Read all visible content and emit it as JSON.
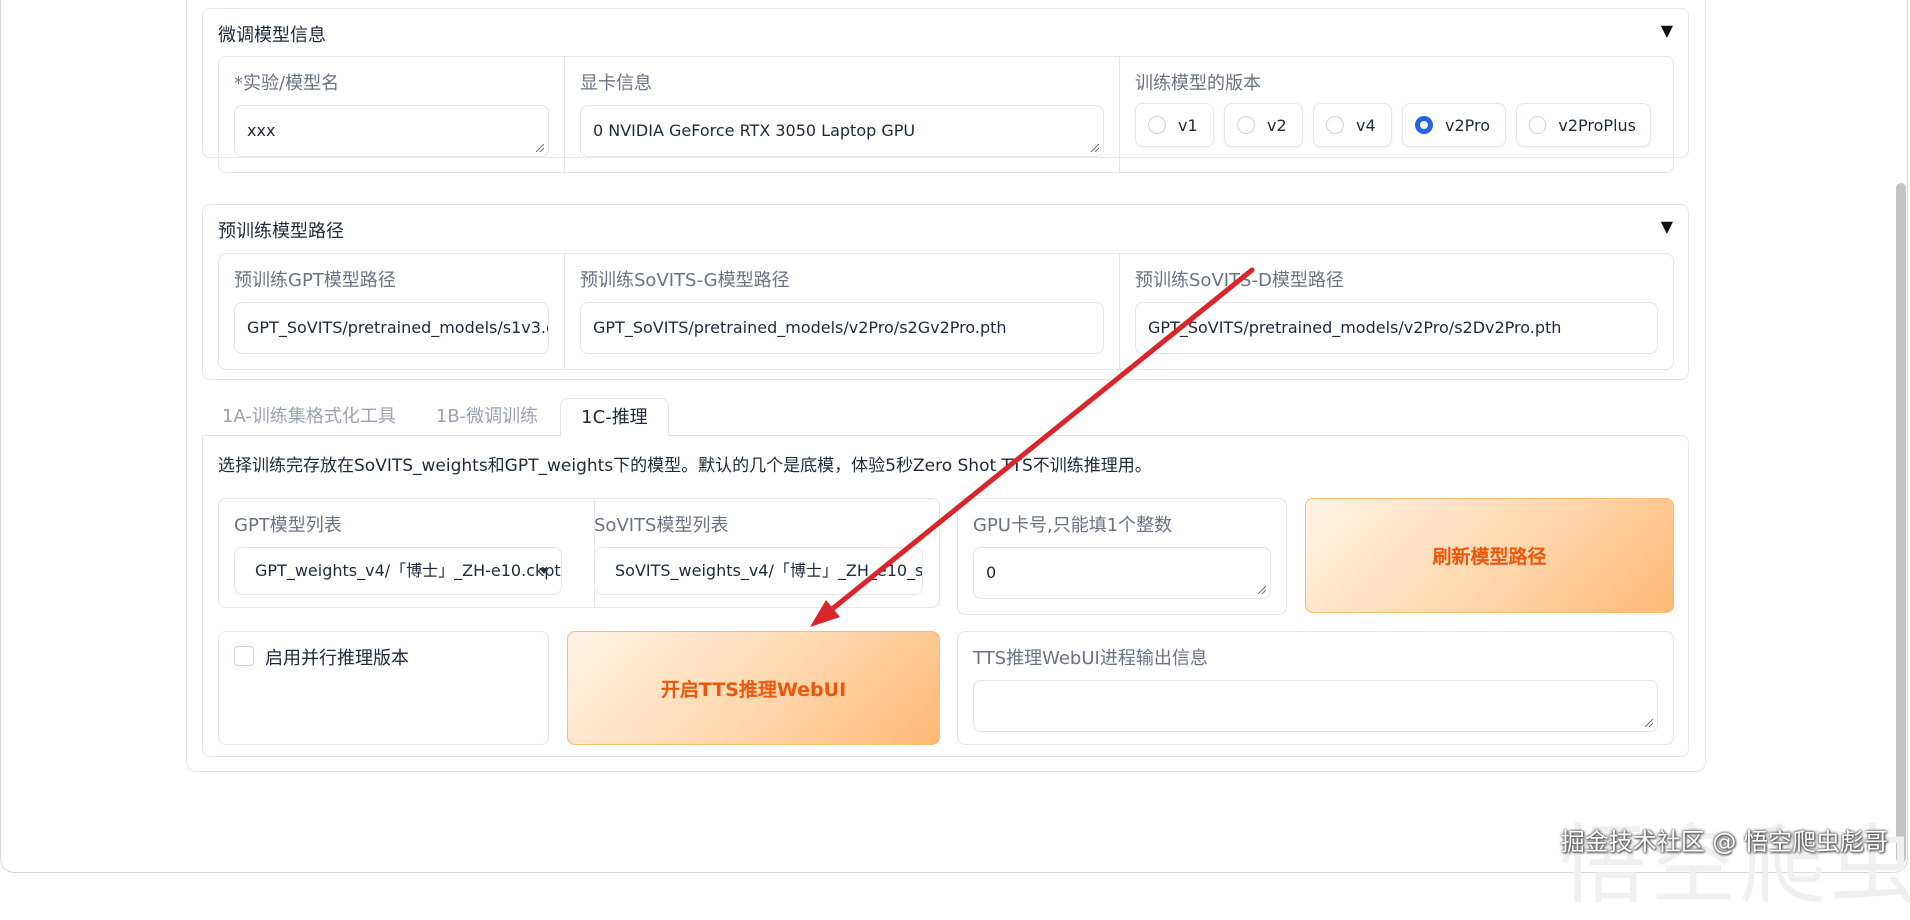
{
  "finetune_info": {
    "title": "微调模型信息",
    "toggle": "▼",
    "exp_name_label": "*实验/模型名",
    "exp_name_value": "xxx",
    "gpu_info_label": "显卡信息",
    "gpu_info_value": "0 NVIDIA GeForce RTX 3050 Laptop GPU",
    "version_label": "训练模型的版本",
    "versions": [
      {
        "label": "v1",
        "checked": false
      },
      {
        "label": "v2",
        "checked": false
      },
      {
        "label": "v4",
        "checked": false
      },
      {
        "label": "v2Pro",
        "checked": true
      },
      {
        "label": "v2ProPlus",
        "checked": false
      }
    ]
  },
  "pretrained": {
    "title": "预训练模型路径",
    "toggle": "▼",
    "gpt_label": "预训练GPT模型路径",
    "gpt_value": "GPT_SoVITS/pretrained_models/s1v3.c",
    "sovits_g_label": "预训练SoVITS-G模型路径",
    "sovits_g_value": "GPT_SoVITS/pretrained_models/v2Pro/s2Gv2Pro.pth",
    "sovits_d_label": "预训练SoVITS-D模型路径",
    "sovits_d_value": "GPT_SoVITS/pretrained_models/v2Pro/s2Dv2Pro.pth"
  },
  "tabs": [
    {
      "label": "1A-训练集格式化工具",
      "active": false
    },
    {
      "label": "1B-微调训练",
      "active": false
    },
    {
      "label": "1C-推理",
      "active": true
    }
  ],
  "inference": {
    "description": "选择训练完存放在SoVITS_weights和GPT_weights下的模型。默认的几个是底模，体验5秒Zero Shot TTS不训练推理用。",
    "gpt_list_label": "GPT模型列表",
    "gpt_list_value": "GPT_weights_v4/「博士」_ZH-e10.ckpt",
    "sovits_list_label": "SoVITS模型列表",
    "sovits_list_value": "SoVITS_weights_v4/「博士」_ZH_e10_s",
    "gpu_card_label": "GPU卡号,只能填1个整数",
    "gpu_card_value": "0",
    "refresh_button": "刷新模型路径",
    "parallel_label": "启用并行推理版本",
    "open_tts_button": "开启TTS推理WebUI",
    "tts_output_label": "TTS推理WebUI进程输出信息",
    "tts_output_value": ""
  },
  "watermark": {
    "text": "掘金技术社区 @ 悟空爬虫彪哥",
    "big_text": "悟空爬虫"
  },
  "colors": {
    "accent": "#2563eb",
    "orange_text": "#ea580c",
    "arrow": "#d9262b"
  }
}
